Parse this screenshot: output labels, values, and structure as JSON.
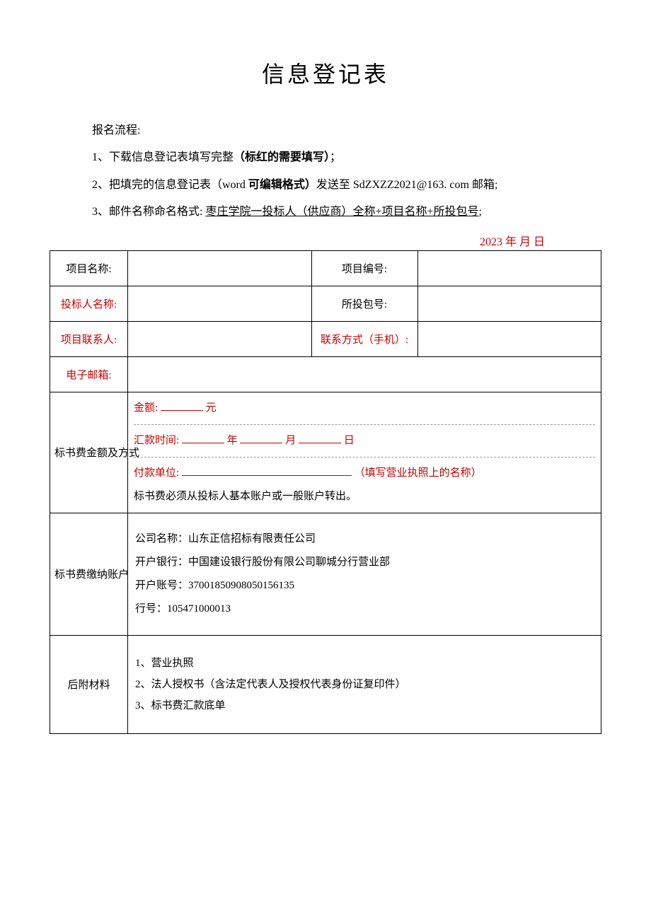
{
  "title": "信息登记表",
  "process": {
    "heading": "报名流程:",
    "line1_a": "1、下载信息登记表填写完整",
    "line1_b": "（标红的需要填写）",
    "line1_c": "；",
    "line2_a": "2、把填完的信息登记表（word ",
    "line2_b": "可编辑格式）",
    "line2_c": "发送至 SdZXZZ2021@163. com 邮箱;",
    "line3_a": "3、邮件名称命名格式: ",
    "line3_b": "枣庄学院一投标人（供应商）全称+项目名称+所投包号",
    "line3_c": ";"
  },
  "date_line": "2023 年 月 日",
  "labels": {
    "proj_name": "项目名称:",
    "proj_no": "项目编号:",
    "bidder_name": "投标人名称:",
    "pkg_no": "所投包号:",
    "contact": "项目联系人:",
    "phone": "联系方式（手机）:",
    "email": "电子邮箱:",
    "fee_method": "标书费金额及方式",
    "fee_account": "标书费缴纳账户",
    "attachments": "后附材料"
  },
  "fee": {
    "amount_label": "金额: ",
    "amount_unit": " 元",
    "remit_label": "汇款时间: ",
    "y": " 年 ",
    "m": " 月 ",
    "d": " 日",
    "payer_label": "付款单位: ",
    "payer_hint": "（填写营业执照上的名称）",
    "payer_note": "标书费必须从投标人基本账户或一般账户转出。"
  },
  "bank": {
    "company": "公司名称：山东正信招标有限责任公司",
    "bank": "开户银行：中国建设银行股份有限公司聊城分行营业部",
    "acct": "开户账号：37001850908050156135",
    "routing": "行号：105471000013"
  },
  "attachments": {
    "a1": "1、营业执照",
    "a2": "2、法人授权书（含法定代表人及授权代表身份证复印件）",
    "a3": "3、标书费汇款底单"
  }
}
